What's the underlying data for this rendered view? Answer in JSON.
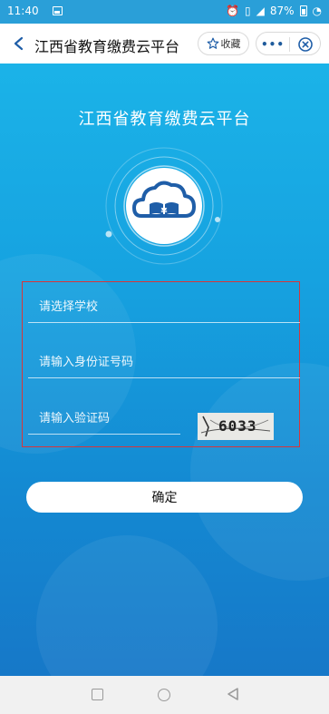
{
  "status_bar": {
    "time": "11:40",
    "battery": "87%",
    "icons": [
      "image-icon",
      "alarm-icon",
      "vibrate-icon",
      "signal-icon",
      "battery-icon",
      "sync-icon"
    ]
  },
  "header": {
    "title": "江西省教育缴费云平台",
    "favorite_label": "收藏",
    "more_label": "•••"
  },
  "main": {
    "app_title": "江西省教育缴费云平台",
    "school_placeholder": "请选择学校",
    "id_placeholder": "请输入身份证号码",
    "captcha_placeholder": "请输入验证码",
    "captcha_text": "6033",
    "confirm_label": "确定"
  },
  "colors": {
    "accent": "#1aa6e0",
    "title_bar": "#ffffff",
    "form_outline": "#d8363a",
    "logo_blue": "#1f5ea8"
  }
}
